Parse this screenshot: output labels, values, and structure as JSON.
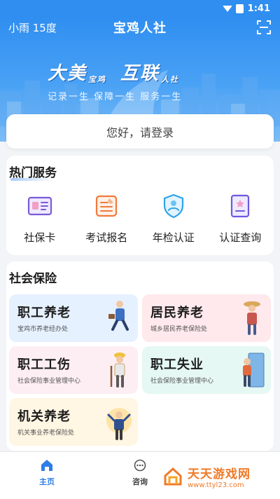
{
  "status_bar": {
    "time": "1:41"
  },
  "header": {
    "weather": "小雨 15度",
    "title": "宝鸡人社",
    "scan_icon": "scan-icon"
  },
  "banner": {
    "slogan_left": "大美",
    "slogan_left_small": "宝鸡",
    "slogan_right": "互联",
    "slogan_right_small": "人社",
    "subtitle": "记录一生  保障一生  服务一生"
  },
  "login": {
    "prompt": "您好，请登录"
  },
  "hot_services": {
    "title": "热门服务",
    "items": [
      {
        "label": "社保卡",
        "icon": "id-card-icon",
        "color": "#7a5ad8"
      },
      {
        "label": "考试报名",
        "icon": "exam-form-icon",
        "color": "#f07a3c"
      },
      {
        "label": "年检认证",
        "icon": "shield-check-icon",
        "color": "#2fa4e7"
      },
      {
        "label": "认证查询",
        "icon": "document-star-icon",
        "color": "#6a5ae0"
      }
    ]
  },
  "social_insurance": {
    "title": "社会保险",
    "tiles": [
      {
        "title": "职工养老",
        "subtitle": "宝鸡市养老经办处",
        "bg": "#e6f1ff"
      },
      {
        "title": "居民养老",
        "subtitle": "城乡居民养老保险处",
        "bg": "#ffe9ec"
      },
      {
        "title": "职工工伤",
        "subtitle": "社会保险事业管理中心",
        "bg": "#fdeef3"
      },
      {
        "title": "职工失业",
        "subtitle": "社会保险事业管理中心",
        "bg": "#e5f8f4"
      },
      {
        "title": "机关养老",
        "subtitle": "机关事业养老保险处",
        "bg": "#fff6e3"
      }
    ]
  },
  "tab_bar": {
    "home": "主页",
    "consult": "咨询"
  },
  "watermark": {
    "name": "天天游戏网",
    "url": "www.ttyl23.com"
  },
  "colors": {
    "primary": "#2f8ef0",
    "active_tab": "#2f7de6"
  }
}
